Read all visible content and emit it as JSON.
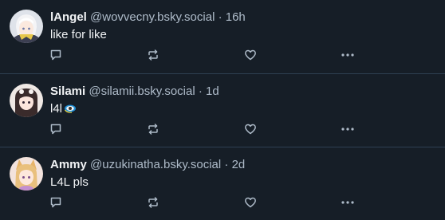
{
  "colors": {
    "background": "#161e27",
    "divider": "#2e4052",
    "text_primary": "#f1f3f5",
    "text_secondary": "#aebbc9",
    "icon": "#aebbc9"
  },
  "icons": {
    "reply": "speech-bubble-icon",
    "repost": "repost-arrows-icon",
    "like": "heart-icon",
    "more": "ellipsis-icon"
  },
  "posts": [
    {
      "display_name": "lAngel",
      "handle": "@wovvecny.bsky.social",
      "separator": "·",
      "time": "16h",
      "text": "like for like",
      "avatar_icon": "white-hair-character-avatar"
    },
    {
      "display_name": "Silami",
      "handle": "@silamii.bsky.social",
      "separator": "·",
      "time": "1d",
      "text": "l4l",
      "emoji": "eye-in-blue-swirl-emoji",
      "avatar_icon": "dark-hair-character-avatar"
    },
    {
      "display_name": "Ammy",
      "handle": "@uzukinatha.bsky.social",
      "separator": "·",
      "time": "2d",
      "text": "L4L pls",
      "avatar_icon": "fox-ear-character-avatar"
    }
  ]
}
